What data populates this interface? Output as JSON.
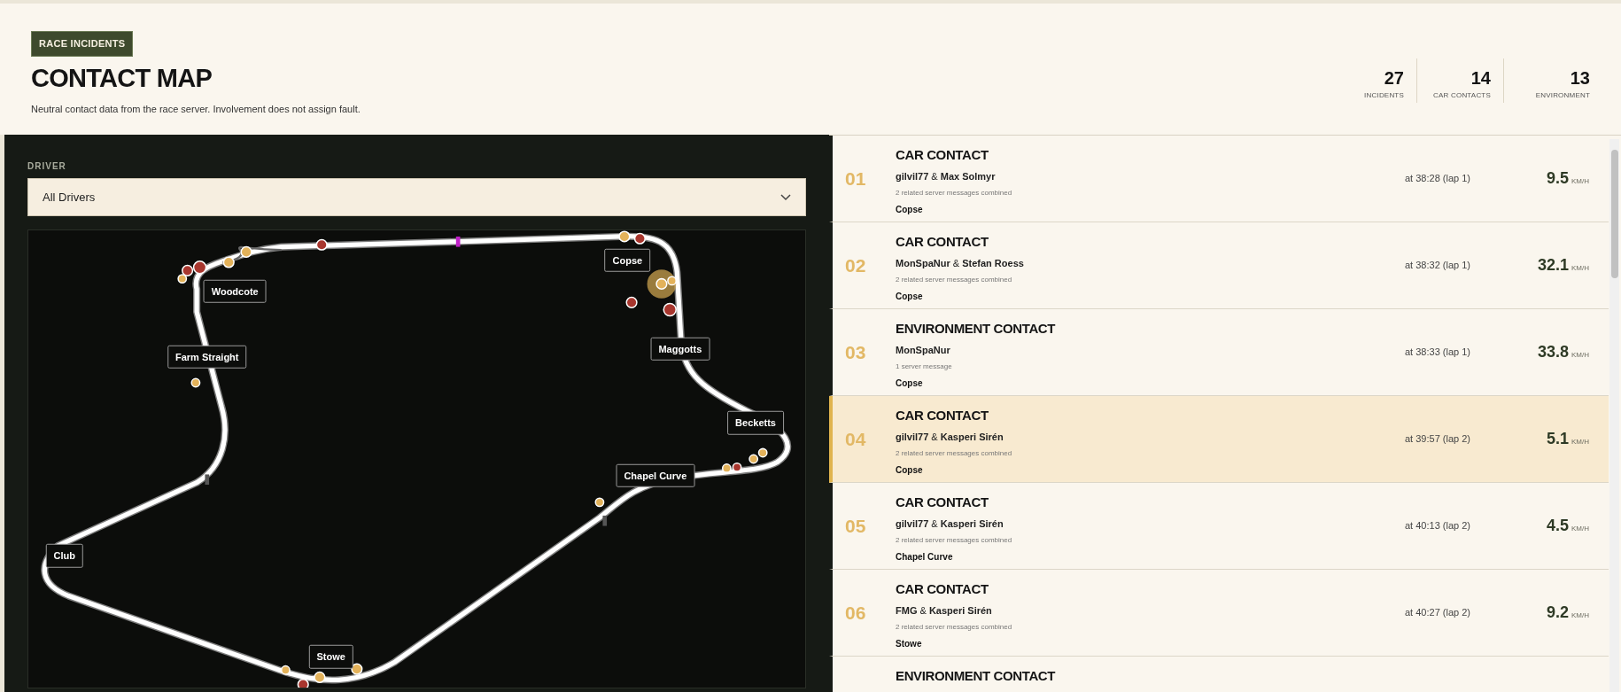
{
  "header": {
    "badge": "RACE INCIDENTS",
    "title": "CONTACT MAP",
    "subtitle": "Neutral contact data from the race server. Involvement does not assign fault.",
    "stats": [
      {
        "value": "27",
        "label": "INCIDENTS"
      },
      {
        "value": "14",
        "label": "CAR CONTACTS"
      },
      {
        "value": "13",
        "label": "ENVIRONMENT"
      }
    ]
  },
  "filter": {
    "label": "DRIVER",
    "value": "All Drivers"
  },
  "map": {
    "labels": [
      "Woodcote",
      "Farm Straight",
      "Copse",
      "Maggotts",
      "Becketts",
      "Chapel Curve",
      "Club",
      "Stowe"
    ],
    "markers": [
      {
        "color": "#e3b25a",
        "selected": false
      },
      {
        "color": "#a8362e",
        "selected": false
      },
      {
        "color": "#a8362e",
        "selected": false
      },
      {
        "color": "#e3b25a",
        "selected": false
      },
      {
        "color": "#e3b25a",
        "selected": false
      },
      {
        "color": "#a8362e",
        "selected": false
      },
      {
        "color": "#e3b25a",
        "selected": false
      },
      {
        "color": "#a8362e",
        "selected": false
      },
      {
        "color": "#e3b25a",
        "selected": true
      },
      {
        "color": "#e3b25a",
        "selected": false
      },
      {
        "color": "#a8362e",
        "selected": false
      },
      {
        "color": "#a8362e",
        "selected": false
      },
      {
        "color": "#e3b25a",
        "selected": false
      },
      {
        "color": "#e3b25a",
        "selected": false
      },
      {
        "color": "#a8362e",
        "selected": false
      },
      {
        "color": "#e3b25a",
        "selected": false
      },
      {
        "color": "#e3b25a",
        "selected": false
      },
      {
        "color": "#e3b25a",
        "selected": false
      },
      {
        "color": "#e3b25a",
        "selected": false
      },
      {
        "color": "#e3b25a",
        "selected": false
      },
      {
        "color": "#e3b25a",
        "selected": false
      },
      {
        "color": "#a8362e",
        "selected": false
      }
    ]
  },
  "incidents": [
    {
      "number": "01",
      "type": "CAR CONTACT",
      "drivers": "**gilvil77** & **Max Solmyr**",
      "note": "2 related server messages combined",
      "location": "Copse",
      "time": "at 38:28 (lap 1)",
      "speed": "9.5",
      "unit": "KM/H",
      "selected": false
    },
    {
      "number": "02",
      "type": "CAR CONTACT",
      "drivers": "**MonSpaNur** & **Stefan Roess**",
      "note": "2 related server messages combined",
      "location": "Copse",
      "time": "at 38:32 (lap 1)",
      "speed": "32.1",
      "unit": "KM/H",
      "selected": false
    },
    {
      "number": "03",
      "type": "ENVIRONMENT CONTACT",
      "drivers": "**MonSpaNur**",
      "note": "1 server message",
      "location": "Copse",
      "time": "at 38:33 (lap 1)",
      "speed": "33.8",
      "unit": "KM/H",
      "selected": false
    },
    {
      "number": "04",
      "type": "CAR CONTACT",
      "drivers": "**gilvil77** & **Kasperi Sirén**",
      "note": "2 related server messages combined",
      "location": "Copse",
      "time": "at 39:57 (lap 2)",
      "speed": "5.1",
      "unit": "KM/H",
      "selected": true
    },
    {
      "number": "05",
      "type": "CAR CONTACT",
      "drivers": "**gilvil77** & **Kasperi Sirén**",
      "note": "2 related server messages combined",
      "location": "Chapel Curve",
      "time": "at 40:13 (lap 2)",
      "speed": "4.5",
      "unit": "KM/H",
      "selected": false
    },
    {
      "number": "06",
      "type": "CAR CONTACT",
      "drivers": "**FMG** & **Kasperi Sirén**",
      "note": "2 related server messages combined",
      "location": "Stowe",
      "time": "at 40:27 (lap 2)",
      "speed": "9.2",
      "unit": "KM/H",
      "selected": false
    },
    {
      "type": "ENVIRONMENT CONTACT"
    }
  ]
}
